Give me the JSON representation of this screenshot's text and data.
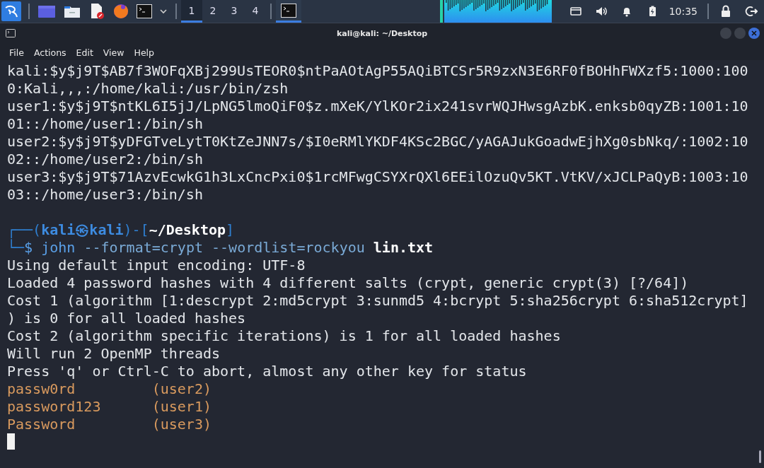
{
  "taskbar": {
    "launchers": [
      {
        "kind": "menu"
      },
      {
        "kind": "desktop"
      },
      {
        "kind": "files"
      },
      {
        "kind": "editor"
      },
      {
        "kind": "browser"
      },
      {
        "kind": "terminal"
      },
      {
        "kind": "dropdown"
      }
    ],
    "workspaces": [
      {
        "label": "1",
        "selected": true
      },
      {
        "label": "2",
        "selected": false
      },
      {
        "label": "3",
        "selected": false
      },
      {
        "label": "4",
        "selected": false
      }
    ],
    "tasks": [
      {
        "kind": "terminal",
        "selected": true
      }
    ],
    "clock": "10:35"
  },
  "window": {
    "title": "kali@kali: ~/Desktop",
    "menu": [
      "File",
      "Actions",
      "Edit",
      "View",
      "Help"
    ],
    "lines": [
      {
        "kind": "plain",
        "text": "kali:$y$j9T$AB7f3WOFqXBj299UsTEOR0$ntPaAOtAgP55AQiBTCSr5R9zxN3E6RF0fBOHhFWXzf5:1000:100"
      },
      {
        "kind": "plain",
        "text": "0:Kali,,,:/home/kali:/usr/bin/zsh"
      },
      {
        "kind": "plain",
        "text": "user1:$y$j9T$ntKL6I5jJ/LpNG5lmoQiF0$z.mXeK/YlKOr2ix241svrWQJHwsgAzbK.enksb0qyZB:1001:10"
      },
      {
        "kind": "plain",
        "text": "01::/home/user1:/bin/sh"
      },
      {
        "kind": "plain",
        "text": "user2:$y$j9T$yDFGTveLytT0KtZeJNN7s/$I0eRMlYKDF4KSc2BGC/yAGAJukGoadwEjhXg0sbNkq/:1002:10"
      },
      {
        "kind": "plain",
        "text": "02::/home/user2:/bin/sh"
      },
      {
        "kind": "plain",
        "text": "user3:$y$j9T$71AzvEcwkG1h3LxCncPxi0$1rcMFwgCSYXrQXl6EEilOzuQv5KT.VtKV/xJCLPaQyB:1003:10"
      },
      {
        "kind": "plain",
        "text": "03::/home/user3:/bin/sh"
      },
      {
        "kind": "blank"
      },
      {
        "kind": "prompt",
        "open": "┌──(",
        "user": "kali",
        "symbol": "㉿",
        "host": "kali",
        "mid": ")-[",
        "path": "~/Desktop",
        "close": "]"
      },
      {
        "kind": "command",
        "corner": "└─",
        "sign": "$",
        "program": "john",
        "args": "--format=crypt --wordlist=rockyou",
        "file": "lin.txt"
      },
      {
        "kind": "plain",
        "text": "Using default input encoding: UTF-8"
      },
      {
        "kind": "plain",
        "text": "Loaded 4 password hashes with 4 different salts (crypt, generic crypt(3) [?/64])"
      },
      {
        "kind": "plain",
        "text": "Cost 1 (algorithm [1:descrypt 2:md5crypt 3:sunmd5 4:bcrypt 5:sha256crypt 6:sha512crypt]"
      },
      {
        "kind": "plain",
        "text": ") is 0 for all loaded hashes"
      },
      {
        "kind": "plain",
        "text": "Cost 2 (algorithm specific iterations) is 1 for all loaded hashes"
      },
      {
        "kind": "plain",
        "text": "Will run 2 OpenMP threads"
      },
      {
        "kind": "plain",
        "text": "Press 'q' or Ctrl-C to abort, almost any other key for status"
      },
      {
        "kind": "cracked",
        "password": "passw0rd",
        "user": "(user2)"
      },
      {
        "kind": "cracked",
        "password": "password123",
        "user": "(user1)"
      },
      {
        "kind": "cracked",
        "password": "Password",
        "user": "(user3)"
      },
      {
        "kind": "cursor"
      }
    ]
  }
}
